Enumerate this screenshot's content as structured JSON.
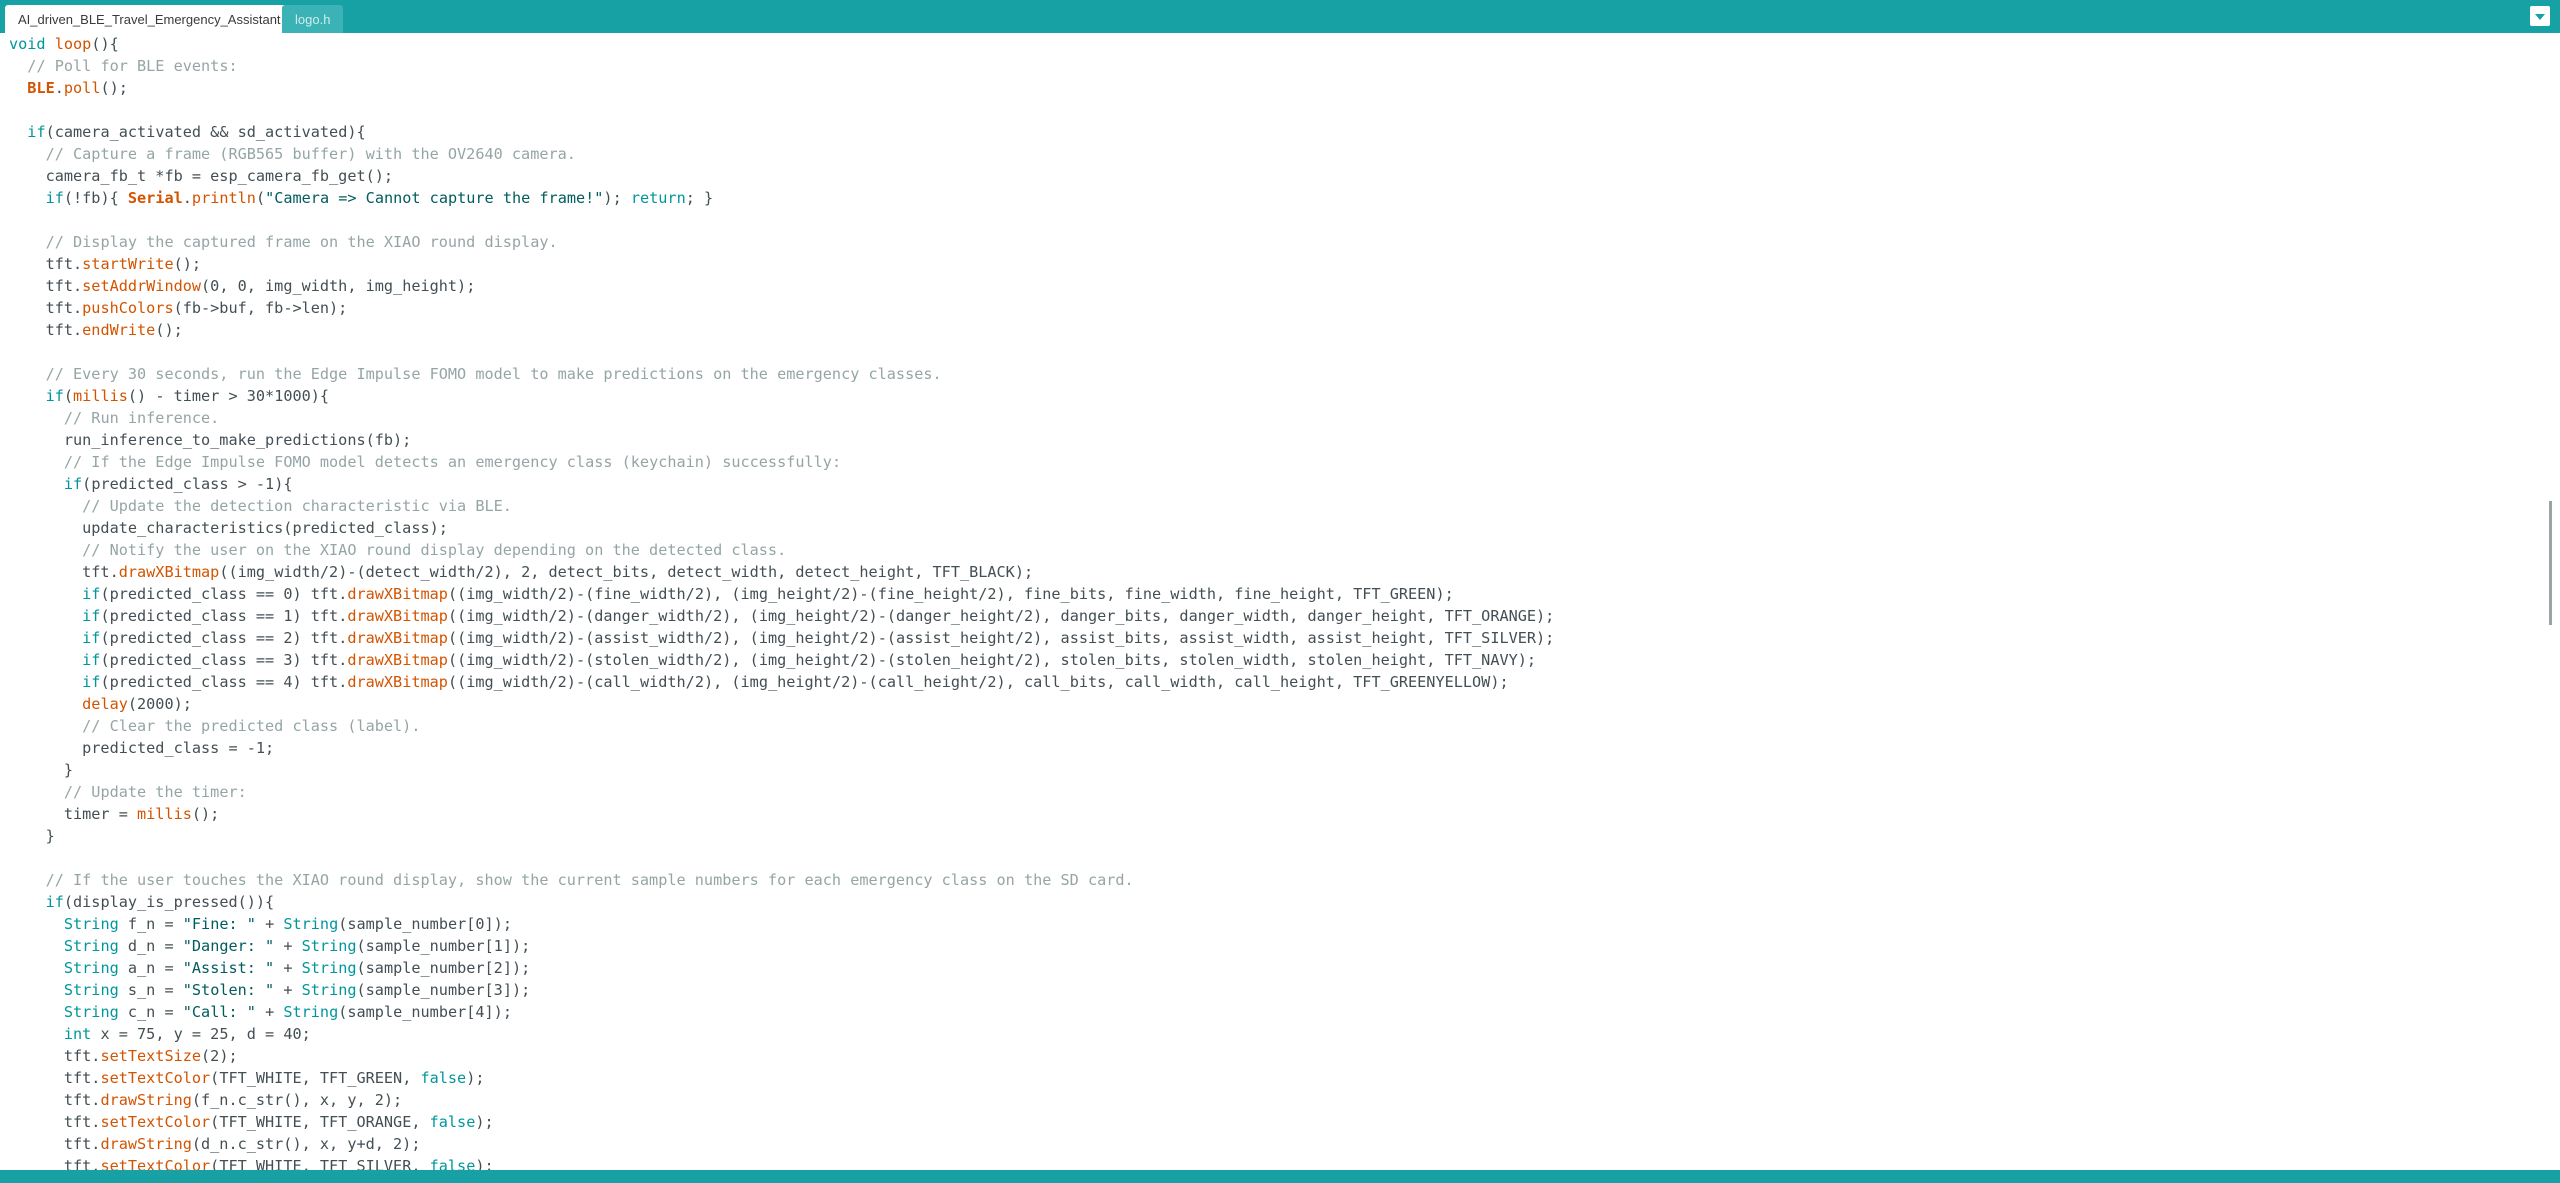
{
  "tabs": [
    {
      "label": "AI_driven_BLE_Travel_Emergency_Assistant",
      "active": true
    },
    {
      "label": "logo.h",
      "active": false
    }
  ],
  "icons": {
    "tab_menu": "chevron-down-icon"
  },
  "colors": {
    "accent": "#17a1a5",
    "keyword": "#00979c",
    "function": "#d35400",
    "string": "#005c5f",
    "comment": "#95a5a6",
    "text": "#434f54"
  },
  "code_lines": [
    [
      [
        "kw",
        "void"
      ],
      [
        "",
        " "
      ],
      [
        "fn",
        "loop"
      ],
      [
        "",
        "(){"
      ]
    ],
    [
      [
        "",
        "  "
      ],
      [
        "cm",
        "// Poll for BLE events:"
      ]
    ],
    [
      [
        "",
        "  "
      ],
      [
        "cls",
        "BLE"
      ],
      [
        "",
        "."
      ],
      [
        "fn",
        "poll"
      ],
      [
        "",
        "();"
      ]
    ],
    [],
    [
      [
        "",
        "  "
      ],
      [
        "kw",
        "if"
      ],
      [
        "",
        "(camera_activated && sd_activated){"
      ]
    ],
    [
      [
        "",
        "    "
      ],
      [
        "cm",
        "// Capture a frame (RGB565 buffer) with the OV2640 camera."
      ]
    ],
    [
      [
        "",
        "    camera_fb_t *fb = esp_camera_fb_get();"
      ]
    ],
    [
      [
        "",
        "    "
      ],
      [
        "kw",
        "if"
      ],
      [
        "",
        "(!fb){ "
      ],
      [
        "cls",
        "Serial"
      ],
      [
        "",
        "."
      ],
      [
        "fn",
        "println"
      ],
      [
        "",
        "("
      ],
      [
        "str",
        "\"Camera => Cannot capture the frame!\""
      ],
      [
        "",
        "); "
      ],
      [
        "kw",
        "return"
      ],
      [
        "",
        "; }"
      ]
    ],
    [],
    [
      [
        "",
        "    "
      ],
      [
        "cm",
        "// Display the captured frame on the XIAO round display."
      ]
    ],
    [
      [
        "",
        "    tft."
      ],
      [
        "fn",
        "startWrite"
      ],
      [
        "",
        "();"
      ]
    ],
    [
      [
        "",
        "    tft."
      ],
      [
        "fn",
        "setAddrWindow"
      ],
      [
        "",
        "(0, 0, img_width, img_height);"
      ]
    ],
    [
      [
        "",
        "    tft."
      ],
      [
        "fn",
        "pushColors"
      ],
      [
        "",
        "(fb->buf, fb->len);"
      ]
    ],
    [
      [
        "",
        "    tft."
      ],
      [
        "fn",
        "endWrite"
      ],
      [
        "",
        "();"
      ]
    ],
    [],
    [
      [
        "",
        "    "
      ],
      [
        "cm",
        "// Every 30 seconds, run the Edge Impulse FOMO model to make predictions on the emergency classes."
      ]
    ],
    [
      [
        "",
        "    "
      ],
      [
        "kw",
        "if"
      ],
      [
        "",
        "("
      ],
      [
        "fn",
        "millis"
      ],
      [
        "",
        "() - timer > 30*1000){"
      ]
    ],
    [
      [
        "",
        "      "
      ],
      [
        "cm",
        "// Run inference."
      ]
    ],
    [
      [
        "",
        "      run_inference_to_make_predictions(fb);"
      ]
    ],
    [
      [
        "",
        "      "
      ],
      [
        "cm",
        "// If the Edge Impulse FOMO model detects an emergency class (keychain) successfully:"
      ]
    ],
    [
      [
        "",
        "      "
      ],
      [
        "kw",
        "if"
      ],
      [
        "",
        "(predicted_class > -1){"
      ]
    ],
    [
      [
        "",
        "        "
      ],
      [
        "cm",
        "// Update the detection characteristic via BLE."
      ]
    ],
    [
      [
        "",
        "        update_characteristics(predicted_class);"
      ]
    ],
    [
      [
        "",
        "        "
      ],
      [
        "cm",
        "// Notify the user on the XIAO round display depending on the detected class."
      ]
    ],
    [
      [
        "",
        "        tft."
      ],
      [
        "fn",
        "drawXBitmap"
      ],
      [
        "",
        "((img_width/2)-(detect_width/2), 2, detect_bits, detect_width, detect_height, TFT_BLACK);"
      ]
    ],
    [
      [
        "",
        "        "
      ],
      [
        "kw",
        "if"
      ],
      [
        "",
        "(predicted_class == 0) tft."
      ],
      [
        "fn",
        "drawXBitmap"
      ],
      [
        "",
        "((img_width/2)-(fine_width/2), (img_height/2)-(fine_height/2), fine_bits, fine_width, fine_height, TFT_GREEN);"
      ]
    ],
    [
      [
        "",
        "        "
      ],
      [
        "kw",
        "if"
      ],
      [
        "",
        "(predicted_class == 1) tft."
      ],
      [
        "fn",
        "drawXBitmap"
      ],
      [
        "",
        "((img_width/2)-(danger_width/2), (img_height/2)-(danger_height/2), danger_bits, danger_width, danger_height, TFT_ORANGE);"
      ]
    ],
    [
      [
        "",
        "        "
      ],
      [
        "kw",
        "if"
      ],
      [
        "",
        "(predicted_class == 2) tft."
      ],
      [
        "fn",
        "drawXBitmap"
      ],
      [
        "",
        "((img_width/2)-(assist_width/2), (img_height/2)-(assist_height/2), assist_bits, assist_width, assist_height, TFT_SILVER);"
      ]
    ],
    [
      [
        "",
        "        "
      ],
      [
        "kw",
        "if"
      ],
      [
        "",
        "(predicted_class == 3) tft."
      ],
      [
        "fn",
        "drawXBitmap"
      ],
      [
        "",
        "((img_width/2)-(stolen_width/2), (img_height/2)-(stolen_height/2), stolen_bits, stolen_width, stolen_height, TFT_NAVY);"
      ]
    ],
    [
      [
        "",
        "        "
      ],
      [
        "kw",
        "if"
      ],
      [
        "",
        "(predicted_class == 4) tft."
      ],
      [
        "fn",
        "drawXBitmap"
      ],
      [
        "",
        "((img_width/2)-(call_width/2), (img_height/2)-(call_height/2), call_bits, call_width, call_height, TFT_GREENYELLOW);"
      ]
    ],
    [
      [
        "",
        "        "
      ],
      [
        "fn",
        "delay"
      ],
      [
        "",
        "(2000);"
      ]
    ],
    [
      [
        "",
        "        "
      ],
      [
        "cm",
        "// Clear the predicted class (label)."
      ]
    ],
    [
      [
        "",
        "        predicted_class = -1;"
      ]
    ],
    [
      [
        "",
        "      }"
      ]
    ],
    [
      [
        "",
        "      "
      ],
      [
        "cm",
        "// Update the timer:"
      ]
    ],
    [
      [
        "",
        "      timer = "
      ],
      [
        "fn",
        "millis"
      ],
      [
        "",
        "();"
      ]
    ],
    [
      [
        "",
        "    }"
      ]
    ],
    [],
    [
      [
        "",
        "    "
      ],
      [
        "cm",
        "// If the user touches the XIAO round display, show the current sample numbers for each emergency class on the SD card."
      ]
    ],
    [
      [
        "",
        "    "
      ],
      [
        "kw",
        "if"
      ],
      [
        "",
        "(display_is_pressed()){"
      ]
    ],
    [
      [
        "",
        "      "
      ],
      [
        "kw",
        "String"
      ],
      [
        "",
        " f_n = "
      ],
      [
        "str",
        "\"Fine: \""
      ],
      [
        "",
        ""
      ],
      [
        "",
        ""
      ],
      [
        "",
        " + "
      ],
      [
        "kw",
        "String"
      ],
      [
        "",
        "(sample_number[0]);"
      ]
    ],
    [
      [
        "",
        "      "
      ],
      [
        "kw",
        "String"
      ],
      [
        "",
        " d_n = "
      ],
      [
        "str",
        "\"Danger: \""
      ],
      [
        "",
        " + "
      ],
      [
        "kw",
        "String"
      ],
      [
        "",
        "(sample_number[1]);"
      ]
    ],
    [
      [
        "",
        "      "
      ],
      [
        "kw",
        "String"
      ],
      [
        "",
        " a_n = "
      ],
      [
        "str",
        "\"Assist: \""
      ],
      [
        "",
        " + "
      ],
      [
        "kw",
        "String"
      ],
      [
        "",
        "(sample_number[2]);"
      ]
    ],
    [
      [
        "",
        "      "
      ],
      [
        "kw",
        "String"
      ],
      [
        "",
        " s_n = "
      ],
      [
        "str",
        "\"Stolen: \""
      ],
      [
        "",
        " + "
      ],
      [
        "kw",
        "String"
      ],
      [
        "",
        "(sample_number[3]);"
      ]
    ],
    [
      [
        "",
        "      "
      ],
      [
        "kw",
        "String"
      ],
      [
        "",
        " c_n = "
      ],
      [
        "str",
        "\"Call: \""
      ],
      [
        "",
        " + "
      ],
      [
        "kw",
        "String"
      ],
      [
        "",
        "(sample_number[4]);"
      ]
    ],
    [
      [
        "",
        "      "
      ],
      [
        "kw",
        "int"
      ],
      [
        "",
        " x = 75, y = 25, d = 40;"
      ]
    ],
    [
      [
        "",
        "      tft."
      ],
      [
        "fn",
        "setTextSize"
      ],
      [
        "",
        "(2);"
      ]
    ],
    [
      [
        "",
        "      tft."
      ],
      [
        "fn",
        "setTextColor"
      ],
      [
        "",
        "(TFT_WHITE, TFT_GREEN, "
      ],
      [
        "kw",
        "false"
      ],
      [
        "",
        ");"
      ]
    ],
    [
      [
        "",
        "      tft."
      ],
      [
        "fn",
        "drawString"
      ],
      [
        "",
        "(f_n.c_str(), x, y, 2);"
      ]
    ],
    [
      [
        "",
        "      tft."
      ],
      [
        "fn",
        "setTextColor"
      ],
      [
        "",
        "(TFT_WHITE, TFT_ORANGE, "
      ],
      [
        "kw",
        "false"
      ],
      [
        "",
        ");"
      ]
    ],
    [
      [
        "",
        "      tft."
      ],
      [
        "fn",
        "drawString"
      ],
      [
        "",
        "(d_n.c_str(), x, y+d, 2);"
      ]
    ],
    [
      [
        "",
        "      tft."
      ],
      [
        "fn",
        "setTextColor"
      ],
      [
        "",
        "(TFT_WHITE, TFT_SILVER, "
      ],
      [
        "kw",
        "false"
      ],
      [
        "",
        ");"
      ]
    ]
  ]
}
